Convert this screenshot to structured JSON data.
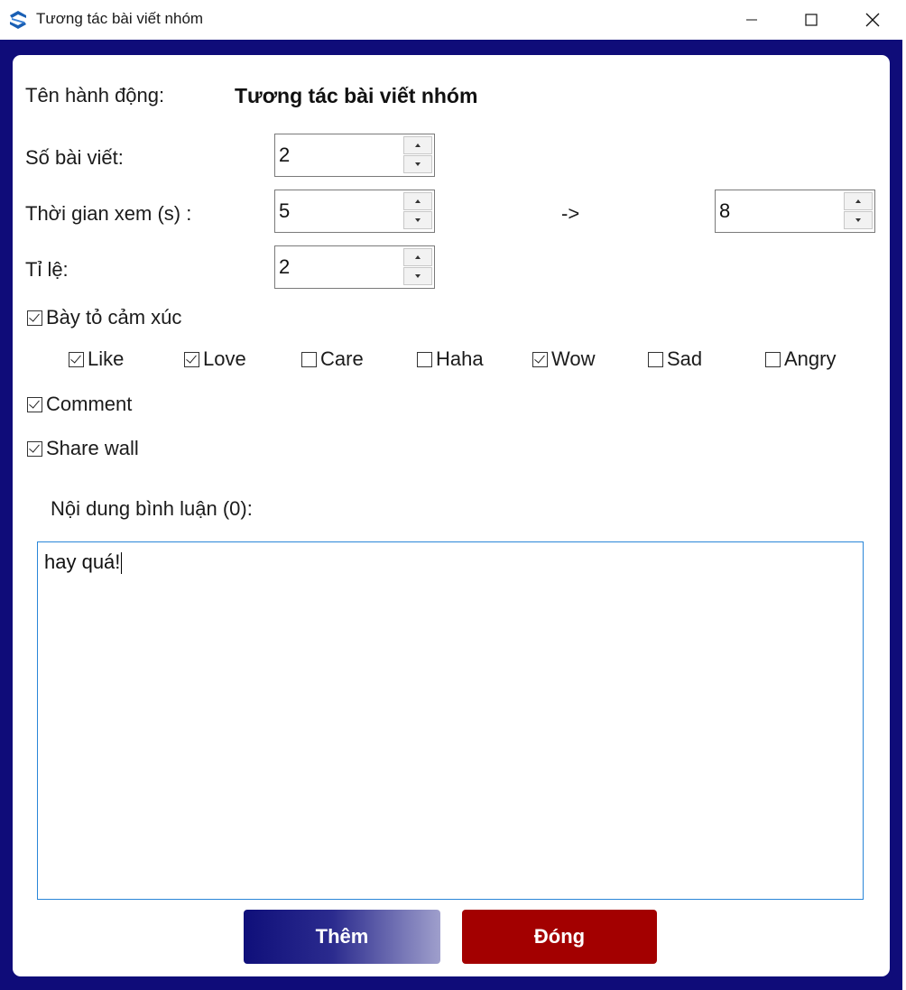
{
  "window": {
    "title": "Tương tác bài viết nhóm"
  },
  "form": {
    "action_label": "Tên hành động:",
    "action_value": "Tương tác bài viết nhóm",
    "posts_label": "Số bài viết:",
    "posts_value": "2",
    "view_time_label": "Thời gian xem (s) :",
    "view_time_from": "5",
    "range_arrow": "->",
    "view_time_to": "8",
    "ratio_label": "Tỉ lệ:",
    "ratio_value": "2",
    "react_label": "Bày tỏ cảm xúc",
    "react_checked": true,
    "reactions": [
      {
        "label": "Like",
        "checked": true
      },
      {
        "label": "Love",
        "checked": true
      },
      {
        "label": "Care",
        "checked": false
      },
      {
        "label": "Haha",
        "checked": false
      },
      {
        "label": "Wow",
        "checked": true
      },
      {
        "label": "Sad",
        "checked": false
      },
      {
        "label": "Angry",
        "checked": false
      }
    ],
    "comment_label": "Comment",
    "comment_checked": true,
    "share_label": "Share wall",
    "share_checked": true,
    "comment_content_label": "Nội dung bình luận (0):",
    "comment_content_value": "hay quá!"
  },
  "buttons": {
    "add": "Thêm",
    "close": "Đóng"
  },
  "colors": {
    "frame": "#0f0c79",
    "add_button": "#0f0f7a",
    "close_button": "#a30000",
    "text_focus_border": "#2a86d8"
  }
}
